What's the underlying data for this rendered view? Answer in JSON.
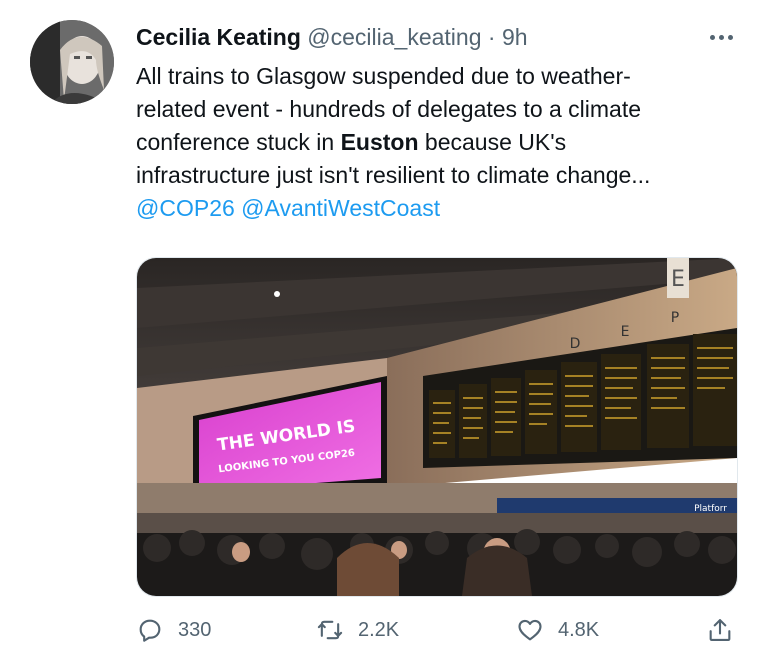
{
  "author": {
    "name": "Cecilia Keating",
    "handle": "@cecilia_keating",
    "separator": "·",
    "time": "9h"
  },
  "tweet": {
    "line1": "All trains to Glasgow suspended due to weather-",
    "line2": "related event -  hundreds of delegates to a climate",
    "line3_pre": "conference stuck in ",
    "line3_bold": "Euston",
    "line3_post": " because UK's",
    "line4": "infrastructure just isn't resilient to climate change...",
    "mention1": "@COP26",
    "mention2": "@AvantiWestCoast"
  },
  "photo": {
    "sign_line1": "THE WORLD IS",
    "sign_line2": "LOOKING TO YOU COP26",
    "station_letters": [
      "E",
      "D",
      "E",
      "P"
    ],
    "platform_sign": "Platforr"
  },
  "actions": {
    "reply_count": "330",
    "retweet_count": "2.2K",
    "like_count": "4.8K"
  },
  "colors": {
    "accent": "#1d9bf0",
    "secondary_text": "#536471",
    "sign_pink": "#e04fd6"
  },
  "icons": [
    "more-icon",
    "reply-icon",
    "retweet-icon",
    "like-icon",
    "share-icon"
  ]
}
